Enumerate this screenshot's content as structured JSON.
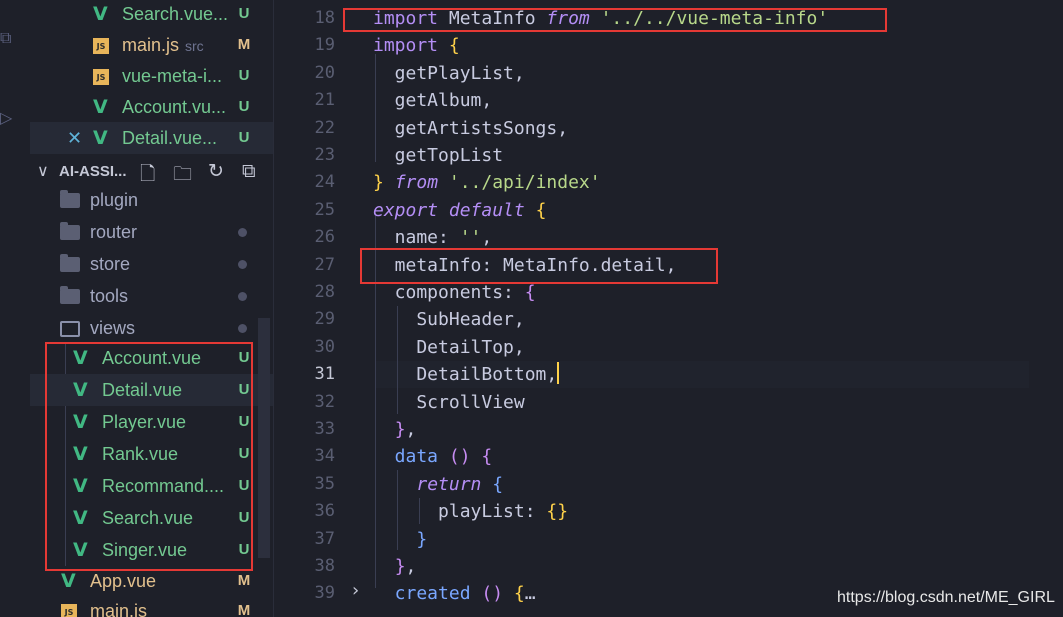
{
  "explorer": {
    "open_files": [
      {
        "name": "Search.vue...",
        "icon": "vue-icon",
        "badge": "U",
        "suffix": ""
      },
      {
        "name": "main.js",
        "icon": "js-icon",
        "badge": "M",
        "suffix": "src"
      },
      {
        "name": "vue-meta-i...",
        "icon": "js-icon",
        "badge": "U",
        "suffix": ""
      },
      {
        "name": "Account.vu...",
        "icon": "vue-icon",
        "badge": "U",
        "suffix": ""
      },
      {
        "name": "Detail.vue...",
        "icon": "vue-icon",
        "badge": "U",
        "suffix": "",
        "close": "✕"
      }
    ],
    "project": {
      "chevron": "∨",
      "title": "AI-ASSI..."
    },
    "folders": [
      {
        "name": "plugin",
        "status": "none"
      },
      {
        "name": "router",
        "status": "dot"
      },
      {
        "name": "store",
        "status": "dot"
      },
      {
        "name": "tools",
        "status": "dot"
      },
      {
        "name": "views",
        "status": "dot"
      }
    ],
    "views_files": [
      {
        "name": "Account.vue",
        "badge": "U"
      },
      {
        "name": "Detail.vue",
        "badge": "U"
      },
      {
        "name": "Player.vue",
        "badge": "U"
      },
      {
        "name": "Rank.vue",
        "badge": "U"
      },
      {
        "name": "Recommand....",
        "badge": "U"
      },
      {
        "name": "Search.vue",
        "badge": "U"
      },
      {
        "name": "Singer.vue",
        "badge": "U"
      }
    ],
    "root_files": [
      {
        "name": "App.vue",
        "icon": "vue-icon",
        "badge": "M"
      },
      {
        "name": "main.js",
        "icon": "js-icon",
        "badge": "M"
      }
    ]
  },
  "editor": {
    "current_line": "31",
    "lines": [
      {
        "n": "18",
        "tokens": [
          [
            "kw2",
            "import "
          ],
          [
            "punc",
            "MetaInfo "
          ],
          [
            "kw",
            "from "
          ],
          [
            "str",
            "'../../vue-meta-info'"
          ]
        ]
      },
      {
        "n": "19",
        "tokens": [
          [
            "kw2",
            "import "
          ],
          [
            "br",
            "{"
          ]
        ]
      },
      {
        "n": "20",
        "tokens": [
          [
            "punc",
            "  getPlayList,"
          ]
        ]
      },
      {
        "n": "21",
        "tokens": [
          [
            "punc",
            "  getAlbum,"
          ]
        ]
      },
      {
        "n": "22",
        "tokens": [
          [
            "punc",
            "  getArtistsSongs,"
          ]
        ]
      },
      {
        "n": "23",
        "tokens": [
          [
            "punc",
            "  getTopList"
          ]
        ]
      },
      {
        "n": "24",
        "tokens": [
          [
            "br",
            "} "
          ],
          [
            "kw",
            "from "
          ],
          [
            "str",
            "'../api/index'"
          ]
        ]
      },
      {
        "n": "25",
        "tokens": [
          [
            "kw",
            "export "
          ],
          [
            "kw",
            "default "
          ],
          [
            "br",
            "{"
          ]
        ]
      },
      {
        "n": "26",
        "tokens": [
          [
            "punc",
            "  name: "
          ],
          [
            "str",
            "''"
          ],
          [
            "punc",
            ","
          ]
        ]
      },
      {
        "n": "27",
        "tokens": [
          [
            "punc",
            "  metaInfo: MetaInfo.detail,"
          ]
        ]
      },
      {
        "n": "28",
        "tokens": [
          [
            "punc",
            "  components: "
          ],
          [
            "br2",
            "{"
          ]
        ]
      },
      {
        "n": "29",
        "tokens": [
          [
            "punc",
            "    SubHeader,"
          ]
        ]
      },
      {
        "n": "30",
        "tokens": [
          [
            "punc",
            "    DetailTop,"
          ]
        ]
      },
      {
        "n": "31",
        "tokens": [
          [
            "punc",
            "    DetailBottom,"
          ],
          [
            "caret",
            ""
          ]
        ]
      },
      {
        "n": "32",
        "tokens": [
          [
            "punc",
            "    ScrollView"
          ]
        ]
      },
      {
        "n": "33",
        "tokens": [
          [
            "punc",
            "  "
          ],
          [
            "br2",
            "}"
          ],
          [
            "punc",
            ","
          ]
        ]
      },
      {
        "n": "34",
        "tokens": [
          [
            "fn",
            "  data "
          ],
          [
            "br2",
            "() "
          ],
          [
            "br2",
            "{"
          ]
        ]
      },
      {
        "n": "35",
        "tokens": [
          [
            "punc",
            "    "
          ],
          [
            "kw",
            "return "
          ],
          [
            "fn",
            "{"
          ]
        ]
      },
      {
        "n": "36",
        "tokens": [
          [
            "punc",
            "      playList: "
          ],
          [
            "br",
            "{}"
          ]
        ]
      },
      {
        "n": "37",
        "tokens": [
          [
            "punc",
            "    "
          ],
          [
            "fn",
            "}"
          ]
        ]
      },
      {
        "n": "38",
        "tokens": [
          [
            "punc",
            "  "
          ],
          [
            "br2",
            "}"
          ],
          [
            "punc",
            ","
          ]
        ]
      },
      {
        "n": "39",
        "tokens": [
          [
            "fn",
            "  created "
          ],
          [
            "br2",
            "() "
          ],
          [
            "br",
            "{"
          ],
          [
            "punc",
            "…"
          ]
        ]
      }
    ]
  },
  "watermark": "https://blog.csdn.net/ME_GIRL",
  "colors": {
    "accent_red": "#e53935",
    "vue_green": "#41b883",
    "badge_modified": "#e2c08d",
    "badge_untracked": "#73c991"
  }
}
